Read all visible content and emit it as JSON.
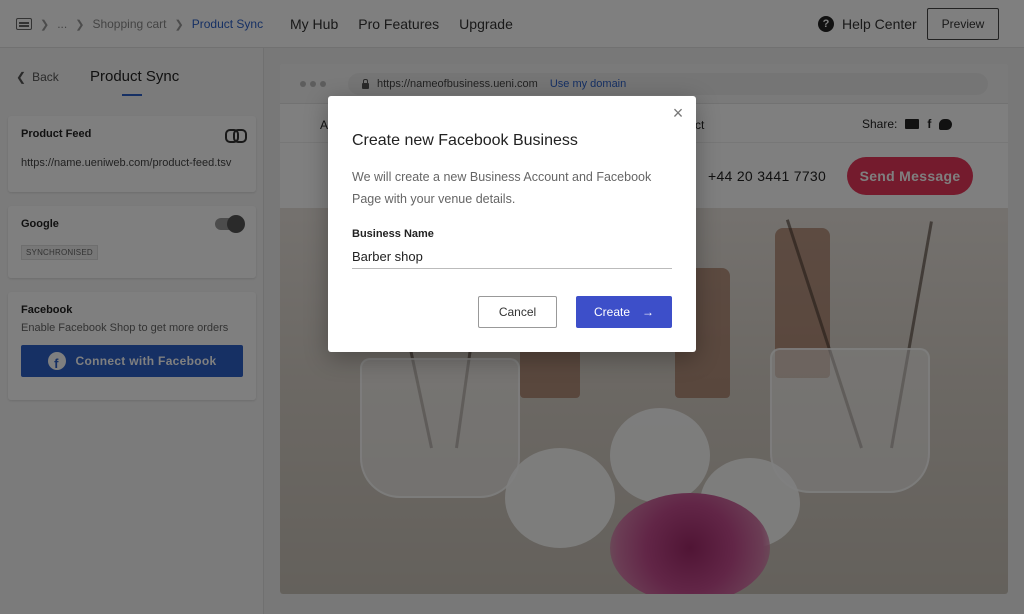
{
  "breadcrumb": {
    "ellipsis": "...",
    "shopping_cart": "Shopping cart",
    "current": "Product Sync"
  },
  "topnav": {
    "my_hub": "My Hub",
    "pro_features": "Pro Features",
    "upgrade": "Upgrade",
    "help_center": "Help Center",
    "preview": "Preview"
  },
  "panel": {
    "back": "Back",
    "title": "Product Sync",
    "product_feed": {
      "title": "Product Feed",
      "url": "https://name.ueniweb.com/product-feed.tsv"
    },
    "google": {
      "title": "Google",
      "status": "SYNCHRONISED",
      "toggle_on": true
    },
    "facebook": {
      "title": "Facebook",
      "description": "Enable Facebook Shop to get more orders",
      "button": "Connect with Facebook"
    }
  },
  "site_preview": {
    "url_prefix": "https://",
    "url_host": "nameofbusiness.ueni.com",
    "use_domain": "Use my domain",
    "nav_fragment_a": "A",
    "nav_fragment_b": "ct",
    "share": "Share:",
    "phone": "+44 20 3441 7730",
    "send_message": "Send Message"
  },
  "modal": {
    "title": "Create new Facebook Business",
    "description": "We will create a new Business Account and Facebook Page with your venue details.",
    "field_label": "Business Name",
    "field_value": "Barber shop",
    "cancel": "Cancel",
    "create": "Create"
  },
  "colors": {
    "accent_blue": "#2c60c8",
    "create_button": "#3d4fc9",
    "send_message": "#e8375b"
  }
}
